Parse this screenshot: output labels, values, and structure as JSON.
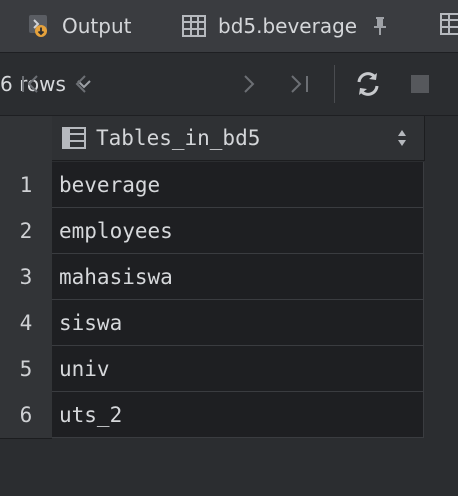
{
  "tabs": [
    {
      "label": "Output",
      "icon": "output-run-icon"
    },
    {
      "label": "bd5.beverage",
      "icon": "table-grid-icon",
      "pinned": true
    }
  ],
  "toolbar": {
    "rows_label": "6 rows"
  },
  "table": {
    "column": "Tables_in_bd5",
    "rows": [
      {
        "num": "1",
        "value": "beverage"
      },
      {
        "num": "2",
        "value": "employees"
      },
      {
        "num": "3",
        "value": "mahasiswa"
      },
      {
        "num": "4",
        "value": "siswa"
      },
      {
        "num": "5",
        "value": "univ"
      },
      {
        "num": "6",
        "value": "uts_2"
      }
    ]
  },
  "colors": {
    "background": "#2b2d30",
    "cell_background": "#1e1f22",
    "output_icon": "#e6a23c"
  }
}
